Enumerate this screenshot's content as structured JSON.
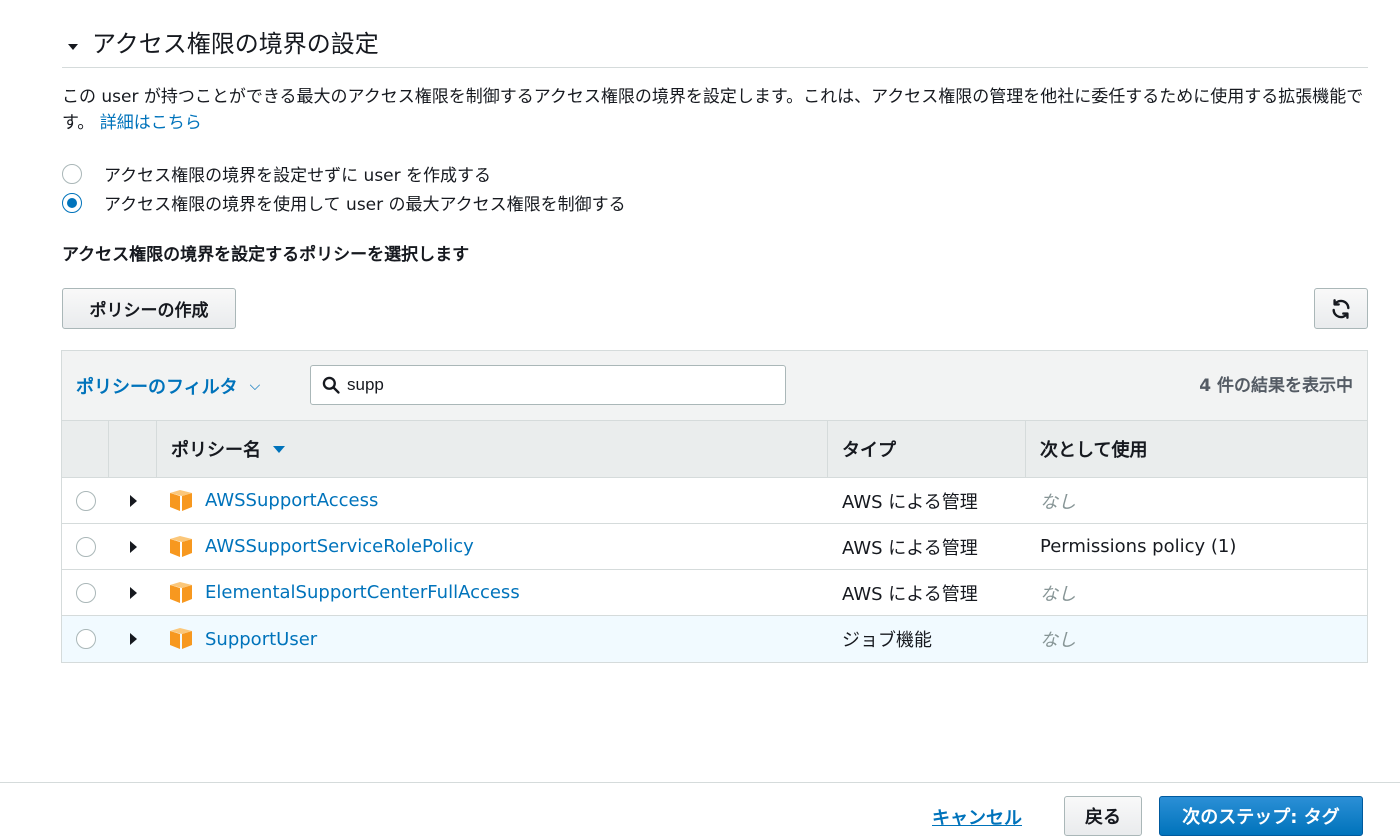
{
  "section": {
    "title": "アクセス権限の境界の設定"
  },
  "description": {
    "text": "この user が持つことができる最大のアクセス権限を制御するアクセス権限の境界を設定します。これは、アクセス権限の管理を他社に委任するために使用する拡張機能です。",
    "link": "詳細はこちら"
  },
  "options": {
    "option1": "アクセス権限の境界を設定せずに user を作成する",
    "option2": "アクセス権限の境界を使用して user の最大アクセス権限を制御する",
    "selected": "option2"
  },
  "subheading": "アクセス権限の境界を設定するポリシーを選択します",
  "toolbar": {
    "create_policy": "ポリシーの作成",
    "refresh_icon": "refresh-icon"
  },
  "table": {
    "filter_label": "ポリシーのフィルタ",
    "search_value": "supp",
    "result_count": "4 件の結果を表示中",
    "headers": {
      "name": "ポリシー名",
      "type": "タイプ",
      "used_as": "次として使用"
    },
    "rows": [
      {
        "name": "AWSSupportAccess",
        "type": "AWS による管理",
        "used_as": "なし"
      },
      {
        "name": "AWSSupportServiceRolePolicy",
        "type": "AWS による管理",
        "used_as": "Permissions policy (1)"
      },
      {
        "name": "ElementalSupportCenterFullAccess",
        "type": "AWS による管理",
        "used_as": "なし"
      },
      {
        "name": "SupportUser",
        "type": "ジョブ機能",
        "used_as": "なし"
      }
    ]
  },
  "footer": {
    "cancel": "キャンセル",
    "back": "戻る",
    "next": "次のステップ: タグ"
  },
  "colors": {
    "link": "#0073bb",
    "policy_icon": "#f7981f",
    "selected_row": "#f1faff"
  }
}
